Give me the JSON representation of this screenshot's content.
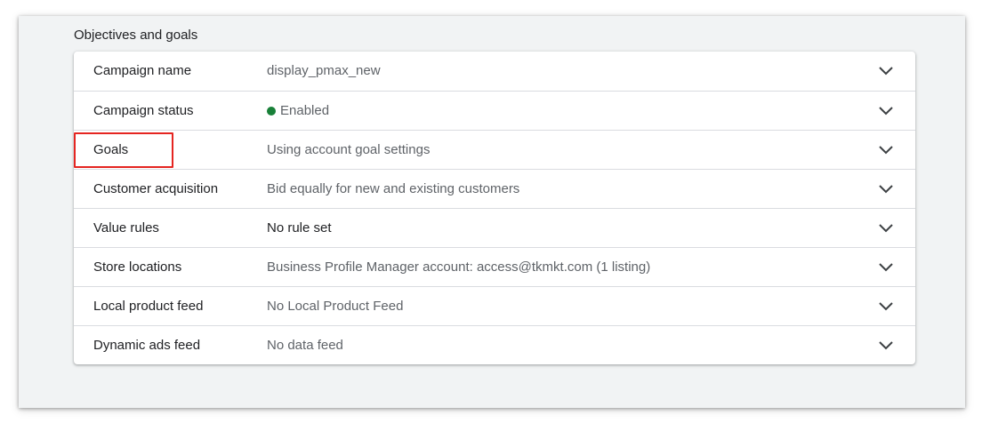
{
  "section": {
    "title": "Objectives and goals"
  },
  "rows": [
    {
      "label": "Campaign name",
      "value": "display_pmax_new"
    },
    {
      "label": "Campaign status",
      "value": "Enabled"
    },
    {
      "label": "Goals",
      "value": "Using account goal settings"
    },
    {
      "label": "Customer acquisition",
      "value": "Bid equally for new and existing customers"
    },
    {
      "label": "Value rules",
      "value": "No rule set"
    },
    {
      "label": "Store locations",
      "value": "Business Profile Manager account: access@tkmkt.com (1 listing)"
    },
    {
      "label": "Local product feed",
      "value": "No Local Product Feed"
    },
    {
      "label": "Dynamic ads feed",
      "value": "No data feed"
    }
  ],
  "icons": {
    "row_expand": "chevron-down-icon",
    "status": "status-dot-icon"
  },
  "colors": {
    "status_enabled": "#188038",
    "highlight": "#e52521",
    "chevron": "#3c4043"
  }
}
